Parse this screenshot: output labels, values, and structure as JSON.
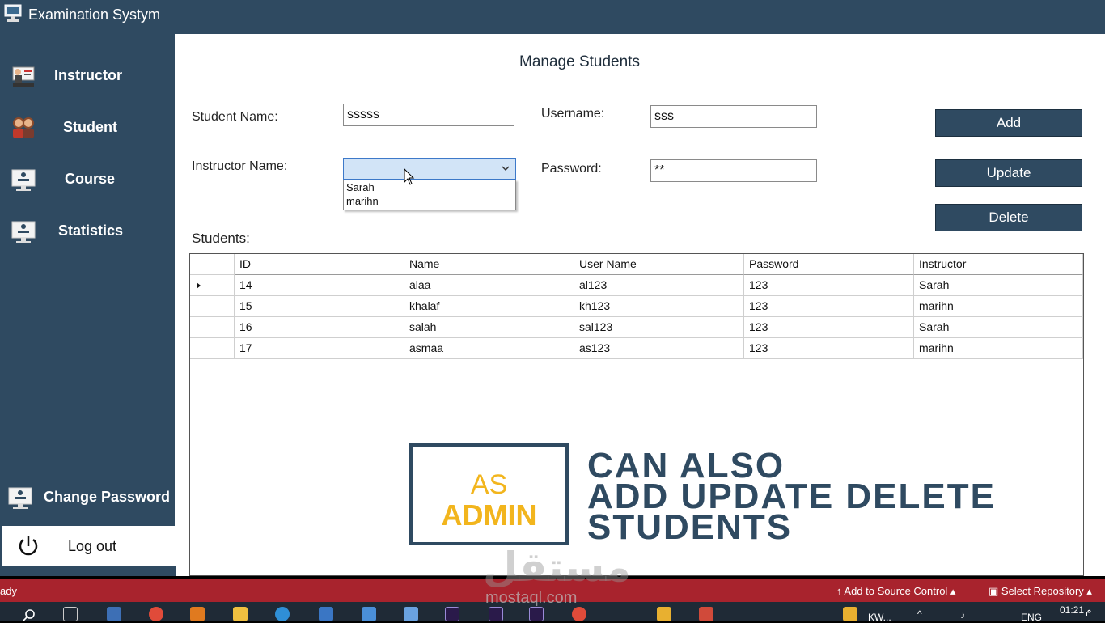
{
  "window": {
    "title": "Examination Systym"
  },
  "sidebar": {
    "items": [
      {
        "label": "Instructor",
        "icon": "instructor-icon"
      },
      {
        "label": "Student",
        "icon": "student-icon"
      },
      {
        "label": "Course",
        "icon": "course-icon"
      },
      {
        "label": "Statistics",
        "icon": "statistics-icon"
      },
      {
        "label": "Change Password",
        "icon": "change-password-icon"
      }
    ],
    "logout_label": "Log out"
  },
  "form": {
    "title": "Manage Students",
    "student_name_label": "Student Name:",
    "student_name_value": "sssss",
    "username_label": "Username:",
    "username_value": "sss",
    "instructor_label": "Instructor Name:",
    "password_label": "Password:",
    "password_value": "**",
    "instructor_options": [
      "Sarah",
      "marihn"
    ]
  },
  "buttons": {
    "add": "Add",
    "update": "Update",
    "delete": "Delete"
  },
  "students_label": "Students:",
  "table": {
    "columns": [
      "ID",
      "Name",
      "User Name",
      "Password",
      "Instructor"
    ],
    "rows": [
      [
        "14",
        "alaa",
        "al123",
        "123",
        "Sarah"
      ],
      [
        "15",
        "khalaf",
        "kh123",
        "123",
        "marihn"
      ],
      [
        "16",
        "salah",
        "sal123",
        "123",
        "Sarah"
      ],
      [
        "17",
        "asmaa",
        "as123",
        "123",
        "marihn"
      ]
    ]
  },
  "overlay": {
    "box_line1": "AS",
    "box_line2": "ADMIN",
    "lines": [
      "CAN ALSO",
      "ADD UPDATE DELETE",
      "STUDENTS"
    ]
  },
  "watermark": {
    "arabic": "مستقل",
    "latin": "mostaql.com"
  },
  "statusbar": {
    "left": "ady",
    "source_control": "Add to Source Control",
    "repository": "Select Repository"
  },
  "taskbar": {
    "task": "KW...",
    "lang": "ENG",
    "time": "01:21",
    "ampm": "م"
  },
  "colors": {
    "accent": "#2f4a61",
    "status": "#a8232d",
    "highlight": "#f2b51d"
  }
}
